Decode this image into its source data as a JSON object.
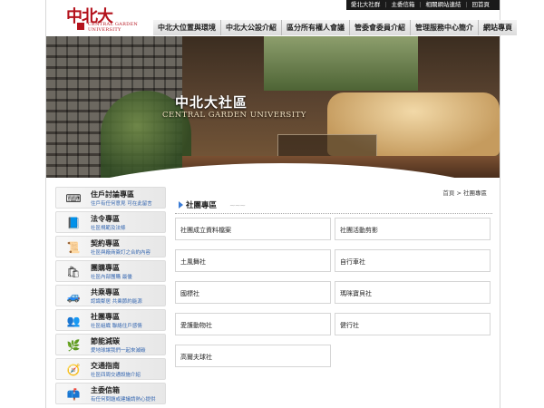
{
  "utility_bar": {
    "items": [
      "愛北大社群",
      "主委信箱",
      "相關網站連結",
      "回首頁"
    ]
  },
  "logo": {
    "brand": "中北大",
    "en_line1": "CENTRAL GARDEN",
    "en_line2": "UNIVERSITY"
  },
  "nav": {
    "items": [
      "中北大位置與環境",
      "中北大公設介紹",
      "區分所有權人會議",
      "管委會委員介紹",
      "管理服務中心簡介",
      "網站專頁"
    ]
  },
  "hero": {
    "title_zh": "中北大社區",
    "title_en": "CENTRAL GARDEN UNIVERSITY"
  },
  "sidebar": {
    "items": [
      {
        "title": "住戶討論專區",
        "sub": "住戶有任何意見 可在此留言",
        "icon": "keyboard-icon"
      },
      {
        "title": "法令專區",
        "sub": "社區規範及法條",
        "icon": "law-book-icon"
      },
      {
        "title": "契約專區",
        "sub": "社區與廠商簽訂之合約內容",
        "icon": "contract-icon"
      },
      {
        "title": "團購專區",
        "sub": "社區內部團購 最優",
        "icon": "shopping-icon"
      },
      {
        "title": "共乘專區",
        "sub": "認識鄰居 共乘節約能源",
        "icon": "car-icon"
      },
      {
        "title": "社團專區",
        "sub": "社區組織 聯絡住戶感情",
        "icon": "group-icon"
      },
      {
        "title": "節能減碳",
        "sub": "愛地球讓我們一起來減碳",
        "icon": "leaf-icon"
      },
      {
        "title": "交通指南",
        "sub": "社區四周交通設施介紹",
        "icon": "traffic-icon"
      },
      {
        "title": "主委信箱",
        "sub": "有任何問題或建議請熱心提供",
        "icon": "mailbox-icon"
      }
    ]
  },
  "breadcrumb": {
    "home": "首頁",
    "separator": ">",
    "current": "社團專區"
  },
  "section": {
    "title": "社團專區",
    "deco": "~~~"
  },
  "clubs": {
    "items": [
      "社團成立資料檔案",
      "社團活動剪影",
      "土風舞社",
      "自行車社",
      "國標社",
      "瑪咪寶貝社",
      "愛護動物社",
      "健行社",
      "高爾夫球社"
    ]
  }
}
